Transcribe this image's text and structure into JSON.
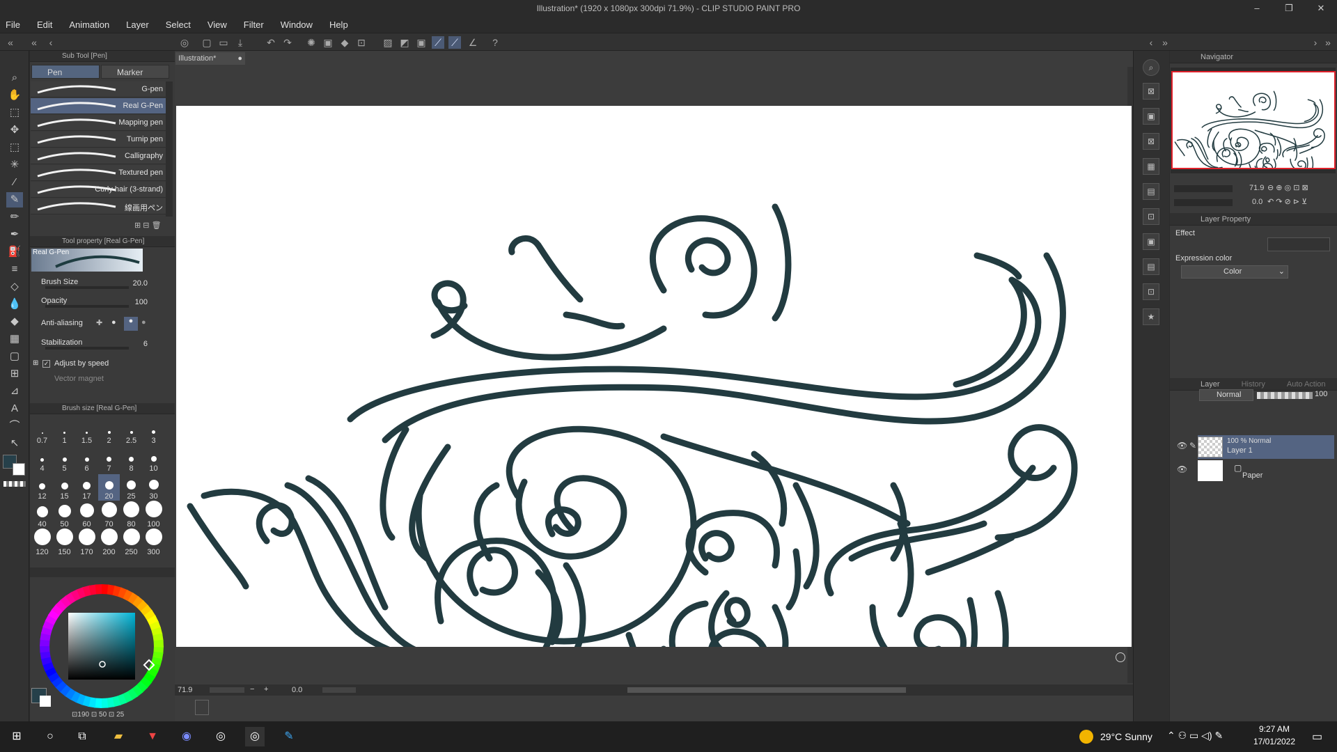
{
  "window": {
    "title": "Illustration* (1920 x 1080px 300dpi 71.9%)  - CLIP STUDIO PAINT PRO",
    "controls": [
      "–",
      "❐",
      "✕"
    ]
  },
  "menu": [
    "File",
    "Edit",
    "Animation",
    "Layer",
    "Select",
    "View",
    "Filter",
    "Window",
    "Help"
  ],
  "subtool_panel": {
    "header": "Sub Tool [Pen]",
    "tabs": [
      "Pen",
      "Marker"
    ],
    "brushes": [
      "G-pen",
      "Real G-Pen",
      "Mapping pen",
      "Turnip pen",
      "Calligraphy",
      "Textured pen",
      "Curly hair (3-strand)",
      "線画用ペン"
    ],
    "selected": "Real G-Pen"
  },
  "tool_property": {
    "header": "Tool property [Real G-Pen]",
    "preview_label": "Real G-Pen",
    "brush_size_label": "Brush Size",
    "brush_size": "20.0",
    "opacity_label": "Opacity",
    "opacity": "100",
    "antialias_label": "Anti-aliasing",
    "stabilization_label": "Stabilization",
    "stabilization": "6",
    "adjust_label": "Adjust by speed",
    "vector_label": "Vector magnet"
  },
  "brush_size_panel": {
    "header": "Brush size [Real G-Pen]",
    "sizes": [
      "0.7",
      "1",
      "1.5",
      "2",
      "2.5",
      "3",
      "4",
      "5",
      "6",
      "7",
      "8",
      "10",
      "12",
      "15",
      "17",
      "20",
      "25",
      "30",
      "40",
      "50",
      "60",
      "70",
      "80",
      "100",
      "120",
      "150",
      "170",
      "200",
      "250",
      "300"
    ],
    "selected": "20"
  },
  "color": {
    "main": "#26404a",
    "sub": "#ffffff",
    "hue_label": "190",
    "sat_label": "50",
    "val_label": "25"
  },
  "document": {
    "tab": "Illustration*",
    "zoom": "71.9",
    "rotation": "0.0",
    "stroke_color": "#223b40"
  },
  "navigator": {
    "header": "Navigator",
    "zoom": "71.9",
    "rotation": "0.0"
  },
  "layer_property": {
    "header": "Layer Property",
    "effect_label": "Effect",
    "expression_label": "Expression color",
    "expression_value": "Color"
  },
  "layer_panel": {
    "tabs": [
      "Layer",
      "History",
      "Auto Action"
    ],
    "blend_mode": "Normal",
    "opacity": "100",
    "layers": [
      {
        "title": "100 % Normal",
        "name": "Layer 1"
      },
      {
        "title": "",
        "name": "Paper"
      }
    ]
  },
  "taskbar": {
    "weather": "29°C  Sunny",
    "time": "9:27 AM",
    "date": "17/01/2022"
  }
}
